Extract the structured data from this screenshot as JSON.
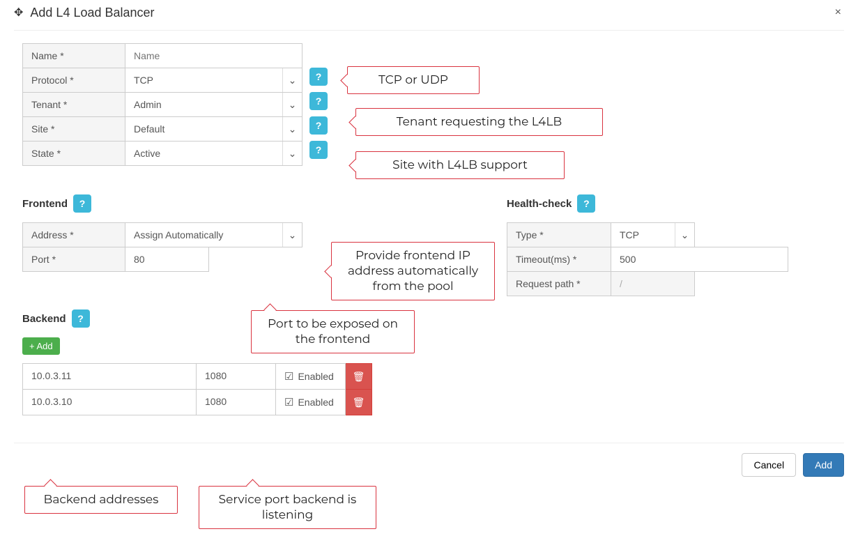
{
  "header": {
    "title": "Add L4 Load Balancer"
  },
  "form": {
    "name": {
      "label": "Name *",
      "placeholder": "Name",
      "value": ""
    },
    "protocol": {
      "label": "Protocol *",
      "value": "TCP"
    },
    "tenant": {
      "label": "Tenant *",
      "value": "Admin"
    },
    "site": {
      "label": "Site *",
      "value": "Default"
    },
    "state": {
      "label": "State *",
      "value": "Active"
    }
  },
  "frontend": {
    "title": "Frontend",
    "address": {
      "label": "Address *",
      "value": "Assign Automatically"
    },
    "port": {
      "label": "Port *",
      "value": "80"
    }
  },
  "healthcheck": {
    "title": "Health-check",
    "type": {
      "label": "Type *",
      "value": "TCP"
    },
    "timeout": {
      "label": "Timeout(ms) *",
      "value": "500"
    },
    "request_path": {
      "label": "Request path *",
      "value": "/"
    }
  },
  "backend": {
    "title": "Backend",
    "add_label": "+ Add",
    "enabled_label": "Enabled",
    "rows": [
      {
        "addr": "10.0.3.11",
        "port": "1080"
      },
      {
        "addr": "10.0.3.10",
        "port": "1080"
      }
    ]
  },
  "footer": {
    "cancel": "Cancel",
    "add": "Add"
  },
  "annotations": {
    "protocol": "TCP or UDP",
    "tenant": "Tenant requesting the L4LB",
    "site": "Site with L4LB support",
    "frontend_ip": "Provide frontend IP address automatically from the pool",
    "frontend_port": "Port to be exposed on the frontend",
    "backend_addr": "Backend addresses",
    "backend_port": "Service port backend is listening"
  }
}
